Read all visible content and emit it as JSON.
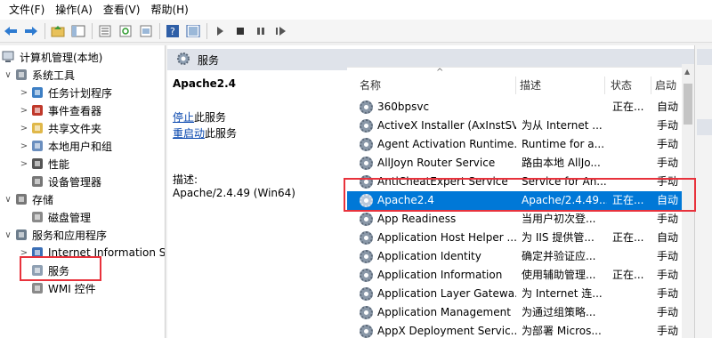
{
  "menu": [
    "文件(F)",
    "操作(A)",
    "查看(V)",
    "帮助(H)"
  ],
  "tree": {
    "root": "计算机管理(本地)",
    "items": [
      {
        "label": "系统工具",
        "level": 1,
        "chev": "∨"
      },
      {
        "label": "任务计划程序",
        "level": 2,
        "chev": ">"
      },
      {
        "label": "事件查看器",
        "level": 2,
        "chev": ">"
      },
      {
        "label": "共享文件夹",
        "level": 2,
        "chev": ">"
      },
      {
        "label": "本地用户和组",
        "level": 2,
        "chev": ">"
      },
      {
        "label": "性能",
        "level": 2,
        "chev": ">"
      },
      {
        "label": "设备管理器",
        "level": 2,
        "chev": ""
      },
      {
        "label": "存储",
        "level": 1,
        "chev": "∨"
      },
      {
        "label": "磁盘管理",
        "level": 2,
        "chev": ""
      },
      {
        "label": "服务和应用程序",
        "level": 1,
        "chev": "∨"
      },
      {
        "label": "Internet Information S",
        "level": 2,
        "chev": ">"
      },
      {
        "label": "服务",
        "level": 2,
        "chev": ""
      },
      {
        "label": "WMI 控件",
        "level": 2,
        "chev": ""
      }
    ]
  },
  "center": {
    "header": "服务",
    "selected_title": "Apache2.4",
    "stop_link": "停止",
    "stop_suffix": "此服务",
    "restart_link": "重启动",
    "restart_suffix": "此服务",
    "desc_label": "描述:",
    "desc_value": "Apache/2.4.49 (Win64)"
  },
  "columns": {
    "name": "名称",
    "desc": "描述",
    "status": "状态",
    "startup": "启动"
  },
  "services": [
    {
      "name": "360bpsvc",
      "desc": "",
      "status": "正在...",
      "startup": "自动"
    },
    {
      "name": "ActiveX Installer (AxInstSV)",
      "desc": "为从 Internet ...",
      "status": "",
      "startup": "手动"
    },
    {
      "name": "Agent Activation Runtime...",
      "desc": "Runtime for a...",
      "status": "",
      "startup": "手动"
    },
    {
      "name": "AllJoyn Router Service",
      "desc": "路由本地 AllJo...",
      "status": "",
      "startup": "手动"
    },
    {
      "name": "AntiCheatExpert Service",
      "desc": "Service for An...",
      "status": "",
      "startup": "手动"
    },
    {
      "name": "Apache2.4",
      "desc": "Apache/2.4.49...",
      "status": "正在...",
      "startup": "自动"
    },
    {
      "name": "App Readiness",
      "desc": "当用户初次登...",
      "status": "",
      "startup": "手动"
    },
    {
      "name": "Application Host Helper ...",
      "desc": "为 IIS 提供管...",
      "status": "正在...",
      "startup": "自动"
    },
    {
      "name": "Application Identity",
      "desc": "确定并验证应...",
      "status": "",
      "startup": "手动"
    },
    {
      "name": "Application Information",
      "desc": "使用辅助管理...",
      "status": "正在...",
      "startup": "手动"
    },
    {
      "name": "Application Layer Gatewa...",
      "desc": "为 Internet 连...",
      "status": "",
      "startup": "手动"
    },
    {
      "name": "Application Management",
      "desc": "为通过组策略...",
      "status": "",
      "startup": "手动"
    },
    {
      "name": "AppX Deployment Servic...",
      "desc": "为部署 Micros...",
      "status": "",
      "startup": "手动"
    }
  ],
  "colors": {
    "selection": "#0078d7",
    "highlight_box": "#e8323c",
    "link": "#0645ad"
  }
}
